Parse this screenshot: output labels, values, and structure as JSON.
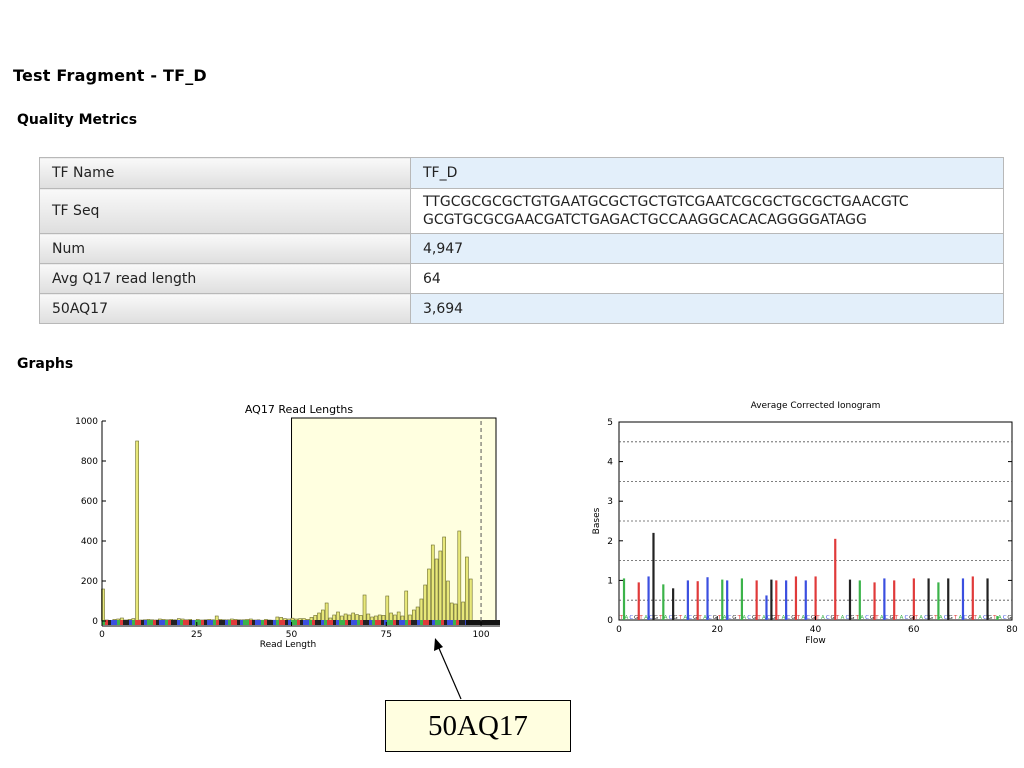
{
  "page": {
    "title": "Test Fragment - TF_D",
    "quality_heading": "Quality Metrics",
    "graphs_heading": "Graphs"
  },
  "metrics": [
    {
      "label": "TF Name",
      "value": "TF_D"
    },
    {
      "label": "TF Seq",
      "value_lines": [
        "TTGCGCGCGCTGTGAATGCGCTGCTGTCGAATCGCGCTGCGCTGAACGTC",
        "GCGTGCGCGAACGATCTGAGACTGCCAAGGCACACAGGGGATAGG"
      ]
    },
    {
      "label": "Num",
      "value": "4,947"
    },
    {
      "label": "Avg Q17 read length",
      "value": "64"
    },
    {
      "label": "50AQ17",
      "value": "3,694"
    }
  ],
  "callout": {
    "label": "50AQ17"
  },
  "colors": {
    "bar": "#e8e87a",
    "highlight": "#ffffe0",
    "A": "#3cb34a",
    "C": "#3b4fe0",
    "G": "#222222",
    "T": "#e03a3a"
  },
  "chart_data": [
    {
      "type": "bar",
      "title": "AQ17 Read Lengths",
      "xlabel": "Read Length",
      "ylabel": "",
      "xlim": [
        0,
        105
      ],
      "ylim": [
        0,
        1000
      ],
      "xticks": [
        0,
        25,
        50,
        75,
        100
      ],
      "yticks": [
        0,
        200,
        400,
        600,
        800,
        1000
      ],
      "highlight_range": [
        50,
        105
      ],
      "dashed_line_x": 100,
      "x": [
        0,
        1,
        2,
        3,
        4,
        5,
        6,
        7,
        8,
        9,
        10,
        11,
        12,
        13,
        14,
        15,
        16,
        17,
        18,
        19,
        20,
        21,
        22,
        23,
        24,
        25,
        26,
        27,
        28,
        29,
        30,
        31,
        32,
        33,
        34,
        35,
        36,
        37,
        38,
        39,
        40,
        41,
        42,
        43,
        44,
        45,
        46,
        47,
        48,
        49,
        50,
        51,
        52,
        53,
        54,
        55,
        56,
        57,
        58,
        59,
        60,
        61,
        62,
        63,
        64,
        65,
        66,
        67,
        68,
        69,
        70,
        71,
        72,
        73,
        74,
        75,
        76,
        77,
        78,
        79,
        80,
        81,
        82,
        83,
        84,
        85,
        86,
        87,
        88,
        89,
        90,
        91,
        92,
        93,
        94,
        95,
        96,
        97,
        98,
        99,
        100
      ],
      "values": [
        160,
        5,
        3,
        8,
        10,
        15,
        5,
        8,
        12,
        900,
        5,
        6,
        8,
        6,
        5,
        10,
        8,
        6,
        8,
        6,
        12,
        10,
        6,
        8,
        4,
        8,
        5,
        6,
        8,
        6,
        25,
        8,
        6,
        6,
        10,
        8,
        6,
        6,
        8,
        10,
        5,
        6,
        4,
        8,
        5,
        4,
        20,
        18,
        12,
        10,
        14,
        10,
        12,
        12,
        8,
        18,
        28,
        40,
        55,
        90,
        15,
        30,
        45,
        25,
        35,
        30,
        40,
        32,
        28,
        130,
        35,
        20,
        25,
        30,
        28,
        125,
        40,
        30,
        45,
        25,
        150,
        30,
        55,
        70,
        110,
        180,
        260,
        380,
        310,
        350,
        420,
        200,
        90,
        85,
        450,
        95,
        320,
        210,
        0,
        0,
        0
      ]
    },
    {
      "type": "bar",
      "title": "Average Corrected Ionogram",
      "xlabel": "Flow",
      "ylabel": "Bases",
      "xlim": [
        0,
        80
      ],
      "ylim": [
        0,
        5
      ],
      "xticks": [
        0,
        20,
        40,
        60,
        80
      ],
      "yticks": [
        0,
        1,
        2,
        3,
        4,
        5
      ],
      "dotted_lines_y": [
        0.5,
        1.5,
        2.5,
        3.5,
        4.5
      ],
      "flow_order": "TACG",
      "flows": [
        1,
        4,
        6,
        7,
        9,
        11,
        14,
        16,
        18,
        21,
        22,
        25,
        28,
        30,
        31,
        32,
        34,
        36,
        38,
        40,
        44,
        47,
        49,
        52,
        54,
        56,
        60,
        63,
        65,
        67,
        70,
        72,
        75,
        77
      ],
      "values": [
        1.05,
        0.95,
        1.1,
        2.2,
        0.9,
        0.8,
        1.0,
        0.98,
        1.08,
        1.02,
        1.0,
        1.05,
        1.0,
        0.62,
        1.02,
        1.0,
        1.0,
        1.1,
        1.0,
        1.1,
        2.05,
        1.02,
        1.0,
        0.95,
        1.05,
        1.0,
        1.05,
        1.05,
        0.95,
        1.05,
        1.05,
        1.1,
        1.05,
        0.1
      ]
    }
  ]
}
